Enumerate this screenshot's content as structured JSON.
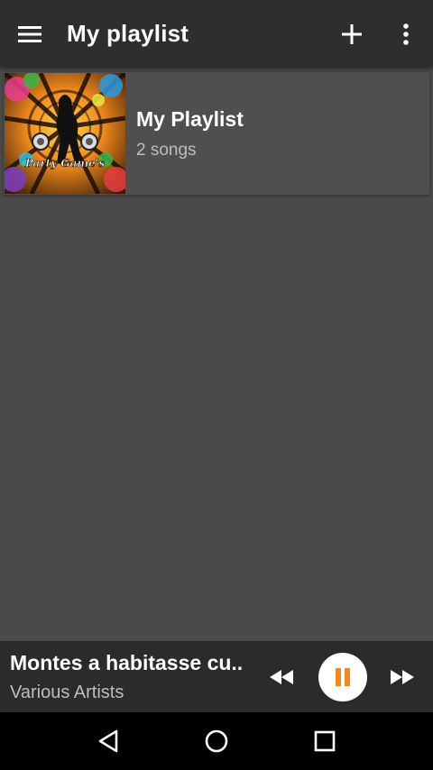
{
  "appbar": {
    "title": "My playlist",
    "icons": {
      "menu": "hamburger-menu-icon",
      "add": "plus-icon",
      "more": "more-vert-icon"
    }
  },
  "playlists": [
    {
      "name": "My Playlist",
      "count": "2 songs",
      "cover_caption": "Party Game's"
    }
  ],
  "player": {
    "title": "Montes a habitasse cu..",
    "artist": "Various Artists",
    "accent": "#f5891f",
    "state": "playing"
  },
  "colors": {
    "appbar": "#2e2e2e",
    "background": "#4a4a4a",
    "card": "#4f4f4f",
    "player": "#2b2b2b",
    "navbar": "#000000",
    "secondary_text": "#bdbdbd"
  }
}
